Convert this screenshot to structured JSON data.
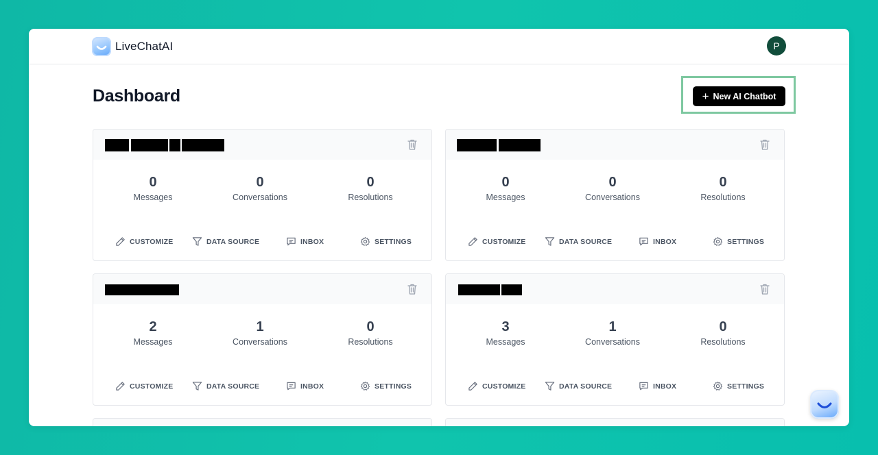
{
  "brand": {
    "name": "LiveChatAI"
  },
  "user": {
    "avatar_initial": "P"
  },
  "page": {
    "title": "Dashboard"
  },
  "toolbar": {
    "new_button_label": "New AI Chatbot"
  },
  "labels": {
    "messages": "Messages",
    "conversations": "Conversations",
    "resolutions": "Resolutions",
    "customize": "CUSTOMIZE",
    "data_source": "DATA SOURCE",
    "inbox": "INBOX",
    "settings": "SETTINGS"
  },
  "cards": [
    {
      "messages": "0",
      "conversations": "0",
      "resolutions": "0"
    },
    {
      "messages": "0",
      "conversations": "0",
      "resolutions": "0"
    },
    {
      "messages": "2",
      "conversations": "1",
      "resolutions": "0"
    },
    {
      "messages": "3",
      "conversations": "1",
      "resolutions": "0"
    }
  ],
  "icons": {
    "logo": "smile-logo-icon",
    "trash": "trash-icon",
    "customize": "pencil-icon",
    "data_source": "filter-icon",
    "inbox": "chat-icon",
    "settings": "gear-icon",
    "chat_widget": "smile-chat-icon"
  },
  "colors": {
    "background": "#10c4ad",
    "primary_button": "#000000",
    "highlight_border": "#7ec8a0",
    "avatar": "#114d3b"
  }
}
